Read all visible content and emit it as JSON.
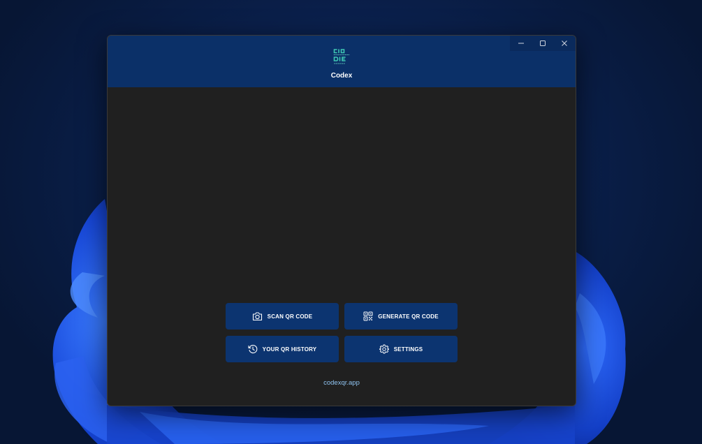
{
  "app": {
    "title": "Codex",
    "logo_icon": "codex-qr-logo",
    "accent_color": "#0b3068",
    "logo_color": "#3fc7b4"
  },
  "window_controls": {
    "minimize_icon": "minimize-icon",
    "maximize_icon": "maximize-icon",
    "close_icon": "close-icon"
  },
  "actions": {
    "scan": {
      "label": "SCAN QR CODE",
      "icon": "camera-icon"
    },
    "generate": {
      "label": "GENERATE QR CODE",
      "icon": "qr-code-icon"
    },
    "history": {
      "label": "YOUR QR HISTORY",
      "icon": "history-icon"
    },
    "settings": {
      "label": "SETTINGS",
      "icon": "gear-icon"
    }
  },
  "footer": {
    "link": "codexqr.app"
  }
}
